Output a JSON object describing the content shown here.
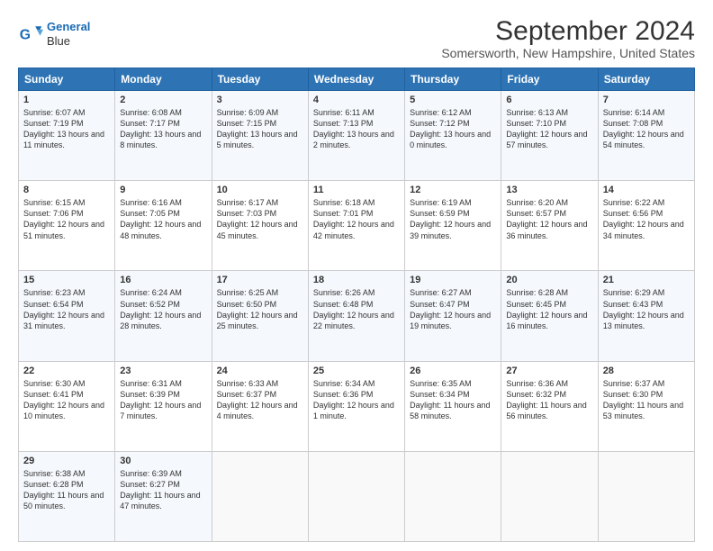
{
  "header": {
    "logo_line1": "General",
    "logo_line2": "Blue",
    "title": "September 2024",
    "subtitle": "Somersworth, New Hampshire, United States"
  },
  "days_of_week": [
    "Sunday",
    "Monday",
    "Tuesday",
    "Wednesday",
    "Thursday",
    "Friday",
    "Saturday"
  ],
  "weeks": [
    [
      {
        "day": "1",
        "sunrise": "6:07 AM",
        "sunset": "7:19 PM",
        "daylight": "13 hours and 11 minutes."
      },
      {
        "day": "2",
        "sunrise": "6:08 AM",
        "sunset": "7:17 PM",
        "daylight": "13 hours and 8 minutes."
      },
      {
        "day": "3",
        "sunrise": "6:09 AM",
        "sunset": "7:15 PM",
        "daylight": "13 hours and 5 minutes."
      },
      {
        "day": "4",
        "sunrise": "6:11 AM",
        "sunset": "7:13 PM",
        "daylight": "13 hours and 2 minutes."
      },
      {
        "day": "5",
        "sunrise": "6:12 AM",
        "sunset": "7:12 PM",
        "daylight": "13 hours and 0 minutes."
      },
      {
        "day": "6",
        "sunrise": "6:13 AM",
        "sunset": "7:10 PM",
        "daylight": "12 hours and 57 minutes."
      },
      {
        "day": "7",
        "sunrise": "6:14 AM",
        "sunset": "7:08 PM",
        "daylight": "12 hours and 54 minutes."
      }
    ],
    [
      {
        "day": "8",
        "sunrise": "6:15 AM",
        "sunset": "7:06 PM",
        "daylight": "12 hours and 51 minutes."
      },
      {
        "day": "9",
        "sunrise": "6:16 AM",
        "sunset": "7:05 PM",
        "daylight": "12 hours and 48 minutes."
      },
      {
        "day": "10",
        "sunrise": "6:17 AM",
        "sunset": "7:03 PM",
        "daylight": "12 hours and 45 minutes."
      },
      {
        "day": "11",
        "sunrise": "6:18 AM",
        "sunset": "7:01 PM",
        "daylight": "12 hours and 42 minutes."
      },
      {
        "day": "12",
        "sunrise": "6:19 AM",
        "sunset": "6:59 PM",
        "daylight": "12 hours and 39 minutes."
      },
      {
        "day": "13",
        "sunrise": "6:20 AM",
        "sunset": "6:57 PM",
        "daylight": "12 hours and 36 minutes."
      },
      {
        "day": "14",
        "sunrise": "6:22 AM",
        "sunset": "6:56 PM",
        "daylight": "12 hours and 34 minutes."
      }
    ],
    [
      {
        "day": "15",
        "sunrise": "6:23 AM",
        "sunset": "6:54 PM",
        "daylight": "12 hours and 31 minutes."
      },
      {
        "day": "16",
        "sunrise": "6:24 AM",
        "sunset": "6:52 PM",
        "daylight": "12 hours and 28 minutes."
      },
      {
        "day": "17",
        "sunrise": "6:25 AM",
        "sunset": "6:50 PM",
        "daylight": "12 hours and 25 minutes."
      },
      {
        "day": "18",
        "sunrise": "6:26 AM",
        "sunset": "6:48 PM",
        "daylight": "12 hours and 22 minutes."
      },
      {
        "day": "19",
        "sunrise": "6:27 AM",
        "sunset": "6:47 PM",
        "daylight": "12 hours and 19 minutes."
      },
      {
        "day": "20",
        "sunrise": "6:28 AM",
        "sunset": "6:45 PM",
        "daylight": "12 hours and 16 minutes."
      },
      {
        "day": "21",
        "sunrise": "6:29 AM",
        "sunset": "6:43 PM",
        "daylight": "12 hours and 13 minutes."
      }
    ],
    [
      {
        "day": "22",
        "sunrise": "6:30 AM",
        "sunset": "6:41 PM",
        "daylight": "12 hours and 10 minutes."
      },
      {
        "day": "23",
        "sunrise": "6:31 AM",
        "sunset": "6:39 PM",
        "daylight": "12 hours and 7 minutes."
      },
      {
        "day": "24",
        "sunrise": "6:33 AM",
        "sunset": "6:37 PM",
        "daylight": "12 hours and 4 minutes."
      },
      {
        "day": "25",
        "sunrise": "6:34 AM",
        "sunset": "6:36 PM",
        "daylight": "12 hours and 1 minute."
      },
      {
        "day": "26",
        "sunrise": "6:35 AM",
        "sunset": "6:34 PM",
        "daylight": "11 hours and 58 minutes."
      },
      {
        "day": "27",
        "sunrise": "6:36 AM",
        "sunset": "6:32 PM",
        "daylight": "11 hours and 56 minutes."
      },
      {
        "day": "28",
        "sunrise": "6:37 AM",
        "sunset": "6:30 PM",
        "daylight": "11 hours and 53 minutes."
      }
    ],
    [
      {
        "day": "29",
        "sunrise": "6:38 AM",
        "sunset": "6:28 PM",
        "daylight": "11 hours and 50 minutes."
      },
      {
        "day": "30",
        "sunrise": "6:39 AM",
        "sunset": "6:27 PM",
        "daylight": "11 hours and 47 minutes."
      },
      null,
      null,
      null,
      null,
      null
    ]
  ]
}
